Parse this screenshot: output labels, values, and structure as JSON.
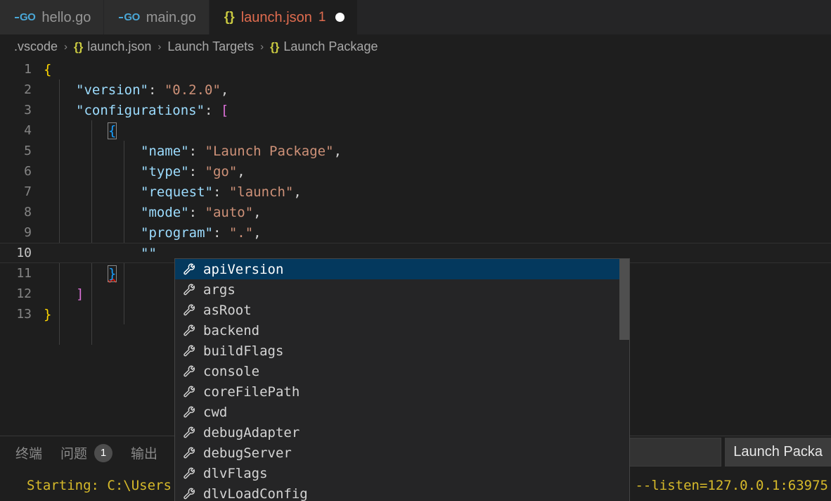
{
  "tabs": [
    {
      "label": "hello.go",
      "icon": "go-file-icon",
      "kind": "go",
      "active": false,
      "dirty": false,
      "errors": ""
    },
    {
      "label": "main.go",
      "icon": "go-file-icon",
      "kind": "go",
      "active": false,
      "dirty": false,
      "errors": ""
    },
    {
      "label": "launch.json",
      "icon": "json-file-icon",
      "kind": "json",
      "active": true,
      "dirty": true,
      "errors": "1"
    }
  ],
  "breadcrumb": {
    "separator": "›",
    "parts": [
      {
        "label": ".vscode",
        "icon": ""
      },
      {
        "label": "launch.json",
        "icon": "{}"
      },
      {
        "label": "Launch Targets",
        "icon": ""
      },
      {
        "label": "Launch Package",
        "icon": "{}"
      }
    ]
  },
  "editor": {
    "current_line": 10,
    "lines": [
      {
        "n": "1",
        "indent": 0,
        "tokens": [
          {
            "t": "{",
            "c": "tk-brace"
          }
        ]
      },
      {
        "n": "2",
        "indent": 1,
        "tokens": [
          {
            "t": "\"version\"",
            "c": "tk-key"
          },
          {
            "t": ": ",
            "c": "tk-punc"
          },
          {
            "t": "\"0.2.0\"",
            "c": "tk-str"
          },
          {
            "t": ",",
            "c": "tk-punc"
          }
        ]
      },
      {
        "n": "3",
        "indent": 1,
        "tokens": [
          {
            "t": "\"configurations\"",
            "c": "tk-key"
          },
          {
            "t": ": ",
            "c": "tk-punc"
          },
          {
            "t": "[",
            "c": "tk-brack"
          }
        ]
      },
      {
        "n": "4",
        "indent": 2,
        "tokens": [
          {
            "t": "{",
            "c": "tk-blue brace-match"
          }
        ]
      },
      {
        "n": "5",
        "indent": 3,
        "tokens": [
          {
            "t": "\"name\"",
            "c": "tk-key"
          },
          {
            "t": ": ",
            "c": "tk-punc"
          },
          {
            "t": "\"Launch Package\"",
            "c": "tk-str"
          },
          {
            "t": ",",
            "c": "tk-punc"
          }
        ]
      },
      {
        "n": "6",
        "indent": 3,
        "tokens": [
          {
            "t": "\"type\"",
            "c": "tk-key"
          },
          {
            "t": ": ",
            "c": "tk-punc"
          },
          {
            "t": "\"go\"",
            "c": "tk-str"
          },
          {
            "t": ",",
            "c": "tk-punc"
          }
        ]
      },
      {
        "n": "7",
        "indent": 3,
        "tokens": [
          {
            "t": "\"request\"",
            "c": "tk-key"
          },
          {
            "t": ": ",
            "c": "tk-punc"
          },
          {
            "t": "\"launch\"",
            "c": "tk-str"
          },
          {
            "t": ",",
            "c": "tk-punc"
          }
        ]
      },
      {
        "n": "8",
        "indent": 3,
        "tokens": [
          {
            "t": "\"mode\"",
            "c": "tk-key"
          },
          {
            "t": ": ",
            "c": "tk-punc"
          },
          {
            "t": "\"auto\"",
            "c": "tk-str"
          },
          {
            "t": ",",
            "c": "tk-punc"
          }
        ]
      },
      {
        "n": "9",
        "indent": 3,
        "tokens": [
          {
            "t": "\"program\"",
            "c": "tk-key"
          },
          {
            "t": ": ",
            "c": "tk-punc"
          },
          {
            "t": "\".\"",
            "c": "tk-str"
          },
          {
            "t": ",",
            "c": "tk-punc"
          }
        ]
      },
      {
        "n": "10",
        "indent": 3,
        "tokens": [
          {
            "t": "\"\"",
            "c": "tk-key"
          }
        ]
      },
      {
        "n": "11",
        "indent": 2,
        "tokens": [
          {
            "t": "}",
            "c": "tk-blue brace-match squiggle"
          }
        ]
      },
      {
        "n": "12",
        "indent": 1,
        "tokens": [
          {
            "t": "]",
            "c": "tk-brack"
          }
        ]
      },
      {
        "n": "13",
        "indent": 0,
        "tokens": [
          {
            "t": "}",
            "c": "tk-brace"
          }
        ]
      }
    ]
  },
  "suggest": {
    "icon_name": "property-wrench-icon",
    "selected_index": 0,
    "items": [
      "apiVersion",
      "args",
      "asRoot",
      "backend",
      "buildFlags",
      "console",
      "coreFilePath",
      "cwd",
      "debugAdapter",
      "debugServer",
      "dlvFlags",
      "dlvLoadConfig"
    ]
  },
  "panel": {
    "tabs": [
      {
        "label": "终端",
        "badge": "",
        "active": false
      },
      {
        "label": "问题",
        "badge": "1",
        "active": false
      },
      {
        "label": "输出",
        "badge": "",
        "active": false
      }
    ],
    "config_select_value": "",
    "launch_button_label": "Launch Packa",
    "terminal_left_text": "Starting: C:\\Users",
    "terminal_right_text": "--listen=127.0.0.1:63975"
  },
  "colors": {
    "editor_bg": "#1e1e1e",
    "tabbar_bg": "#252526",
    "tab_inactive_bg": "#2d2d2d",
    "accent_selection": "#04395e",
    "error": "#e51400",
    "tab_error_text": "#e06c4f",
    "terminal_yellow": "#d7ba2a",
    "json_brace": "#cbcb41"
  }
}
